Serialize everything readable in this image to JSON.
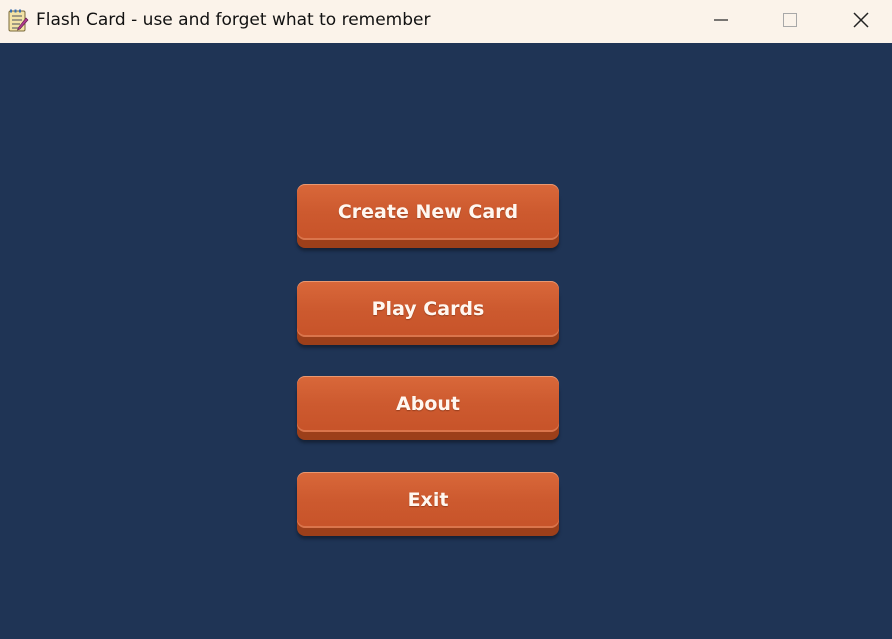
{
  "window": {
    "title": "Flash Card - use and forget what to remember",
    "icon": "notepad-icon",
    "controls": [
      "minimize-icon",
      "maximize-icon",
      "close-icon"
    ]
  },
  "menu": {
    "buttons": [
      {
        "label": "Create New Card"
      },
      {
        "label": "Play Cards"
      },
      {
        "label": "About"
      },
      {
        "label": "Exit"
      }
    ]
  },
  "colors": {
    "background": "#1f3455",
    "titlebar": "#fbf3ea",
    "button": "#cd5a2f",
    "button_shadow": "#9c3f1a",
    "button_text": "#fff7f0"
  }
}
